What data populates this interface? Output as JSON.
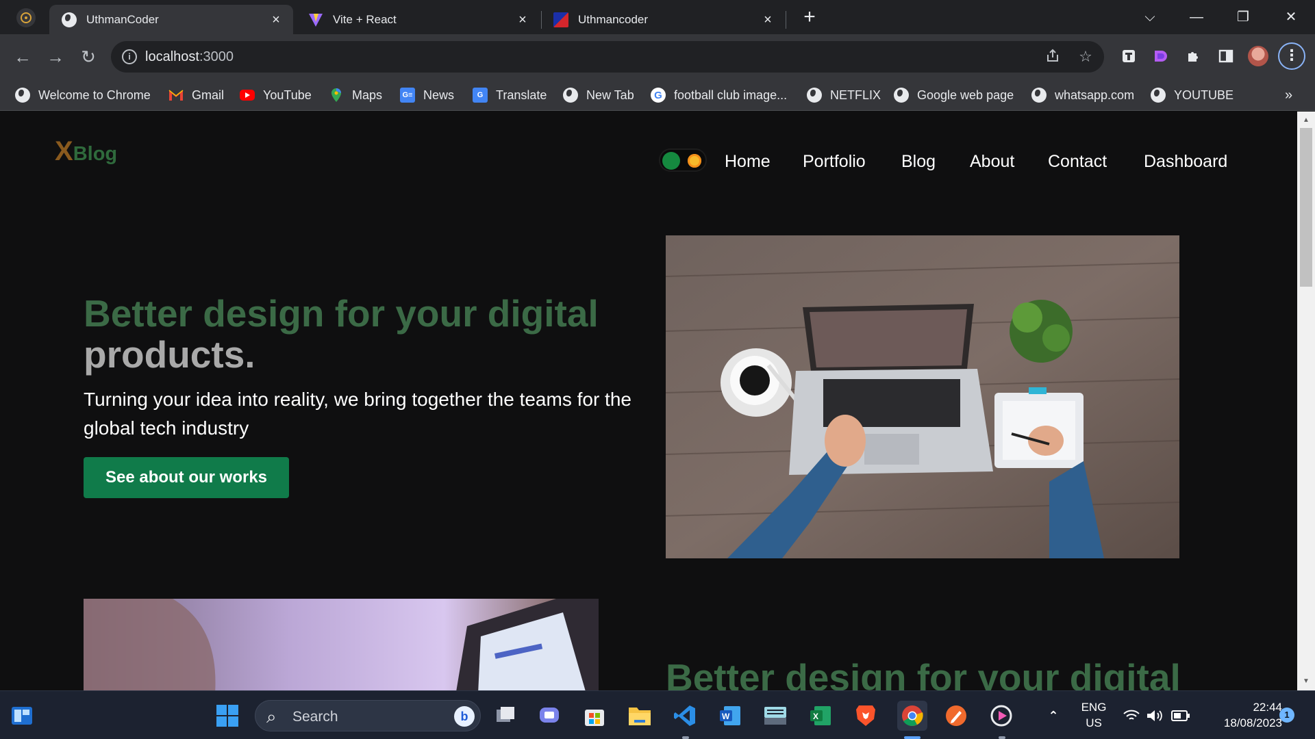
{
  "browser": {
    "tabs": [
      {
        "title": "UthmanCoder",
        "active": true
      },
      {
        "title": "Vite + React",
        "active": false
      },
      {
        "title": "Uthmancoder",
        "active": false
      }
    ],
    "tab_close": "×",
    "new_tab": "+",
    "window_controls": [
      "⌵",
      "—",
      "❐",
      "✕"
    ],
    "nav": {
      "back": "←",
      "forward": "→",
      "reload": "↻"
    },
    "url": {
      "host": "localhost",
      "port": ":3000"
    },
    "menu_glyph": "⋮",
    "bookmarks": [
      {
        "label": "Welcome to Chrome",
        "icon": "globe-icon"
      },
      {
        "label": "Gmail",
        "icon": "gmail-icon"
      },
      {
        "label": "YouTube",
        "icon": "youtube-icon"
      },
      {
        "label": "Maps",
        "icon": "maps-icon"
      },
      {
        "label": "News",
        "icon": "news-icon"
      },
      {
        "label": "Translate",
        "icon": "translate-icon"
      },
      {
        "label": "New Tab",
        "icon": "globe-icon"
      },
      {
        "label": "football club image...",
        "icon": "google-icon"
      },
      {
        "label": "NETFLIX",
        "icon": "globe-icon"
      },
      {
        "label": "Google web page",
        "icon": "globe-icon"
      },
      {
        "label": "whatsapp.com",
        "icon": "globe-icon"
      },
      {
        "label": "YOUTUBE",
        "icon": "globe-icon"
      }
    ],
    "bookmarks_more": "»"
  },
  "site": {
    "logo": {
      "x": "X",
      "name": "Blog"
    },
    "nav": [
      "Home",
      "Portfolio",
      "Blog",
      "About",
      "Contact",
      "Dashboard"
    ],
    "hero": {
      "title_green": "Better design for your digital",
      "title_gray": "products.",
      "subtitle": "Turning your idea into reality, we bring together the teams for the global tech industry",
      "cta": "See about our works"
    },
    "section2_title": "Better design for your digital"
  },
  "taskbar": {
    "search_placeholder": "Search",
    "lang": "ENG",
    "region": "US",
    "time": "22:44",
    "date": "18/08/2023",
    "notifications": "1"
  },
  "colors": {
    "accent_green": "#107b4a",
    "title_green": "#3b6a46",
    "logo_orange": "#8a5a1e",
    "page_bg": "#0f0f10"
  }
}
